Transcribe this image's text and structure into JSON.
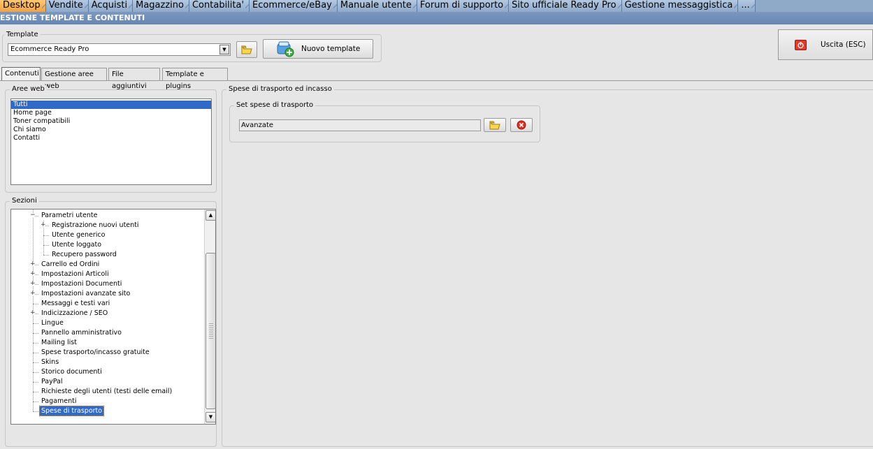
{
  "menu": {
    "items": [
      {
        "label": "Desktop",
        "active": true
      },
      {
        "label": "Vendite"
      },
      {
        "label": "Acquisti"
      },
      {
        "label": "Magazzino"
      },
      {
        "label": "Contabilita'"
      },
      {
        "label": "Ecommerce/eBay"
      },
      {
        "label": "Manuale utente"
      },
      {
        "label": "Forum di supporto"
      },
      {
        "label": "Sito ufficiale Ready Pro"
      },
      {
        "label": "Gestione messaggistica"
      },
      {
        "label": "..."
      }
    ]
  },
  "window": {
    "title": "ESTIONE TEMPLATE E CONTENUTI"
  },
  "template": {
    "group_label": "Template",
    "selected": "Ecommerce Ready Pro",
    "new_button": "Nuovo template"
  },
  "exit": {
    "label": "Uscita (ESC)"
  },
  "tabs": [
    {
      "label": "Contenuti",
      "active": true
    },
    {
      "label": "Gestione aree web"
    },
    {
      "label": "File aggiuntivi"
    },
    {
      "label": "Template e plugins"
    }
  ],
  "aree_web": {
    "label": "Aree web",
    "items": [
      "Tutti",
      "Home page",
      "Toner compatibili",
      "Chi siamo",
      "Contatti"
    ],
    "selected_index": 0
  },
  "sezioni": {
    "label": "Sezioni",
    "items": [
      {
        "label": "Parametri utente",
        "level": 0,
        "expander": "minus"
      },
      {
        "label": "Registrazione nuovi utenti",
        "level": 1,
        "expander": "plus"
      },
      {
        "label": "Utente generico",
        "level": 1
      },
      {
        "label": "Utente loggato",
        "level": 1
      },
      {
        "label": "Recupero password",
        "level": 1
      },
      {
        "label": "Carrello ed Ordini",
        "level": 0,
        "expander": "plus"
      },
      {
        "label": "Impostazioni Articoli",
        "level": 0,
        "expander": "plus"
      },
      {
        "label": "Impostazioni Documenti",
        "level": 0,
        "expander": "plus"
      },
      {
        "label": "Impostazioni avanzate sito",
        "level": 0,
        "expander": "plus"
      },
      {
        "label": "Messaggi e testi vari",
        "level": 0
      },
      {
        "label": "Indicizzazione / SEO",
        "level": 0,
        "expander": "plus"
      },
      {
        "label": "Lingue",
        "level": 0
      },
      {
        "label": "Pannello amministrativo",
        "level": 0
      },
      {
        "label": "Mailing list",
        "level": 0
      },
      {
        "label": "Spese trasporto/incasso gratuite",
        "level": 0
      },
      {
        "label": "Skins",
        "level": 0
      },
      {
        "label": "Storico documenti",
        "level": 0
      },
      {
        "label": "PayPal",
        "level": 0
      },
      {
        "label": "Richieste degli utenti (testi delle email)",
        "level": 0
      },
      {
        "label": "Pagamenti",
        "level": 0
      },
      {
        "label": "Spese di trasporto",
        "level": 0,
        "selected": true
      }
    ]
  },
  "right_panel": {
    "label": "Spese di trasporto ed incasso",
    "set_label": "Set spese di trasporto",
    "value": "Avanzate"
  },
  "colors": {
    "menu_bg": "#8fa9c9",
    "menu_active": "#f2a23e",
    "title_bg": "#6f8cb6",
    "selection": "#3169c6"
  },
  "icons": {
    "folder": "folder-icon",
    "delete": "delete-icon",
    "new_template": "new-template-icon",
    "exit": "power-icon",
    "scroll_up": "arrow-up-icon",
    "scroll_down": "arrow-down-icon"
  }
}
